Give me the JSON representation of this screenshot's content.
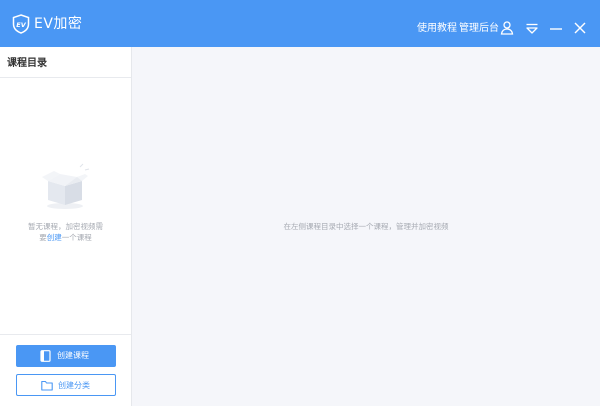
{
  "app": {
    "title": "EV加密",
    "logo_icon": "ev-shield-logo"
  },
  "header": {
    "tutorial_link": "使用教程",
    "admin_link": "管理后台",
    "icons": [
      "user-icon",
      "menu-dropdown-icon",
      "minimize-icon",
      "close-icon"
    ]
  },
  "sidebar": {
    "title": "课程目录",
    "empty_state": {
      "icon": "empty-box-icon",
      "line1": "暂无课程，加密视频需",
      "line2_prefix": "要",
      "line2_link": "创建",
      "line2_suffix": "一个课程"
    },
    "buttons": {
      "create_course": "创建课程",
      "create_category": "创建分类"
    }
  },
  "main": {
    "hint": "在左侧课程目录中选择一个课程，管理并加密视频"
  },
  "colors": {
    "accent": "#4a97f4",
    "muted_text": "#a6aab2",
    "main_bg": "#f5f6fa"
  }
}
